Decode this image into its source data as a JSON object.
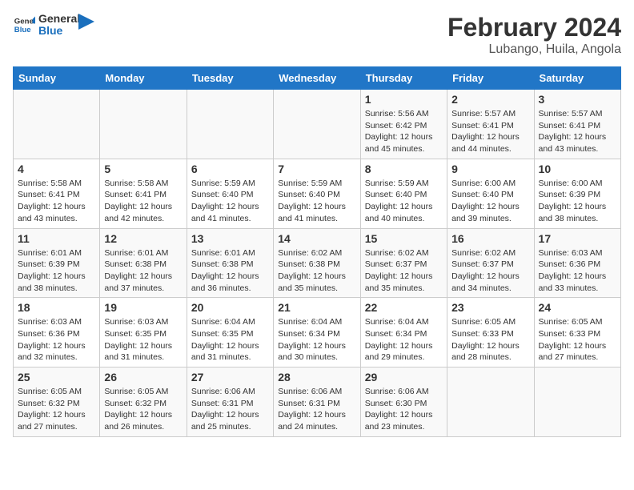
{
  "header": {
    "logo_line1": "General",
    "logo_line2": "Blue",
    "title": "February 2024",
    "subtitle": "Lubango, Huila, Angola"
  },
  "weekdays": [
    "Sunday",
    "Monday",
    "Tuesday",
    "Wednesday",
    "Thursday",
    "Friday",
    "Saturday"
  ],
  "weeks": [
    [
      {
        "day": "",
        "detail": ""
      },
      {
        "day": "",
        "detail": ""
      },
      {
        "day": "",
        "detail": ""
      },
      {
        "day": "",
        "detail": ""
      },
      {
        "day": "1",
        "detail": "Sunrise: 5:56 AM\nSunset: 6:42 PM\nDaylight: 12 hours\nand 45 minutes."
      },
      {
        "day": "2",
        "detail": "Sunrise: 5:57 AM\nSunset: 6:41 PM\nDaylight: 12 hours\nand 44 minutes."
      },
      {
        "day": "3",
        "detail": "Sunrise: 5:57 AM\nSunset: 6:41 PM\nDaylight: 12 hours\nand 43 minutes."
      }
    ],
    [
      {
        "day": "4",
        "detail": "Sunrise: 5:58 AM\nSunset: 6:41 PM\nDaylight: 12 hours\nand 43 minutes."
      },
      {
        "day": "5",
        "detail": "Sunrise: 5:58 AM\nSunset: 6:41 PM\nDaylight: 12 hours\nand 42 minutes."
      },
      {
        "day": "6",
        "detail": "Sunrise: 5:59 AM\nSunset: 6:40 PM\nDaylight: 12 hours\nand 41 minutes."
      },
      {
        "day": "7",
        "detail": "Sunrise: 5:59 AM\nSunset: 6:40 PM\nDaylight: 12 hours\nand 41 minutes."
      },
      {
        "day": "8",
        "detail": "Sunrise: 5:59 AM\nSunset: 6:40 PM\nDaylight: 12 hours\nand 40 minutes."
      },
      {
        "day": "9",
        "detail": "Sunrise: 6:00 AM\nSunset: 6:40 PM\nDaylight: 12 hours\nand 39 minutes."
      },
      {
        "day": "10",
        "detail": "Sunrise: 6:00 AM\nSunset: 6:39 PM\nDaylight: 12 hours\nand 38 minutes."
      }
    ],
    [
      {
        "day": "11",
        "detail": "Sunrise: 6:01 AM\nSunset: 6:39 PM\nDaylight: 12 hours\nand 38 minutes."
      },
      {
        "day": "12",
        "detail": "Sunrise: 6:01 AM\nSunset: 6:38 PM\nDaylight: 12 hours\nand 37 minutes."
      },
      {
        "day": "13",
        "detail": "Sunrise: 6:01 AM\nSunset: 6:38 PM\nDaylight: 12 hours\nand 36 minutes."
      },
      {
        "day": "14",
        "detail": "Sunrise: 6:02 AM\nSunset: 6:38 PM\nDaylight: 12 hours\nand 35 minutes."
      },
      {
        "day": "15",
        "detail": "Sunrise: 6:02 AM\nSunset: 6:37 PM\nDaylight: 12 hours\nand 35 minutes."
      },
      {
        "day": "16",
        "detail": "Sunrise: 6:02 AM\nSunset: 6:37 PM\nDaylight: 12 hours\nand 34 minutes."
      },
      {
        "day": "17",
        "detail": "Sunrise: 6:03 AM\nSunset: 6:36 PM\nDaylight: 12 hours\nand 33 minutes."
      }
    ],
    [
      {
        "day": "18",
        "detail": "Sunrise: 6:03 AM\nSunset: 6:36 PM\nDaylight: 12 hours\nand 32 minutes."
      },
      {
        "day": "19",
        "detail": "Sunrise: 6:03 AM\nSunset: 6:35 PM\nDaylight: 12 hours\nand 31 minutes."
      },
      {
        "day": "20",
        "detail": "Sunrise: 6:04 AM\nSunset: 6:35 PM\nDaylight: 12 hours\nand 31 minutes."
      },
      {
        "day": "21",
        "detail": "Sunrise: 6:04 AM\nSunset: 6:34 PM\nDaylight: 12 hours\nand 30 minutes."
      },
      {
        "day": "22",
        "detail": "Sunrise: 6:04 AM\nSunset: 6:34 PM\nDaylight: 12 hours\nand 29 minutes."
      },
      {
        "day": "23",
        "detail": "Sunrise: 6:05 AM\nSunset: 6:33 PM\nDaylight: 12 hours\nand 28 minutes."
      },
      {
        "day": "24",
        "detail": "Sunrise: 6:05 AM\nSunset: 6:33 PM\nDaylight: 12 hours\nand 27 minutes."
      }
    ],
    [
      {
        "day": "25",
        "detail": "Sunrise: 6:05 AM\nSunset: 6:32 PM\nDaylight: 12 hours\nand 27 minutes."
      },
      {
        "day": "26",
        "detail": "Sunrise: 6:05 AM\nSunset: 6:32 PM\nDaylight: 12 hours\nand 26 minutes."
      },
      {
        "day": "27",
        "detail": "Sunrise: 6:06 AM\nSunset: 6:31 PM\nDaylight: 12 hours\nand 25 minutes."
      },
      {
        "day": "28",
        "detail": "Sunrise: 6:06 AM\nSunset: 6:31 PM\nDaylight: 12 hours\nand 24 minutes."
      },
      {
        "day": "29",
        "detail": "Sunrise: 6:06 AM\nSunset: 6:30 PM\nDaylight: 12 hours\nand 23 minutes."
      },
      {
        "day": "",
        "detail": ""
      },
      {
        "day": "",
        "detail": ""
      }
    ]
  ]
}
